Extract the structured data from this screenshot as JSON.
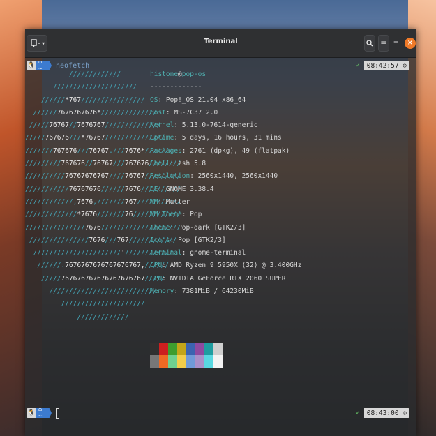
{
  "window": {
    "title": "Terminal"
  },
  "prompt1": {
    "dir_glyph": "⌂ ~",
    "command": "neofetch",
    "check": "✓",
    "time": "08:42:57"
  },
  "prompt2": {
    "dir_glyph": "⌂ ~",
    "check": "✓",
    "time": "08:43:00"
  },
  "user": {
    "name": "histone",
    "at": "@",
    "host": "pop-os",
    "separator": "-------------"
  },
  "info": [
    {
      "k": "OS",
      "v": "Pop!_OS 21.04 x86_64"
    },
    {
      "k": "Host",
      "v": "MS-7C37 2.0"
    },
    {
      "k": "Kernel",
      "v": "5.13.0-7614-generic"
    },
    {
      "k": "Uptime",
      "v": "5 days, 16 hours, 31 mins"
    },
    {
      "k": "Packages",
      "v": "2761 (dpkg), 49 (flatpak)"
    },
    {
      "k": "Shell",
      "v": "zsh 5.8"
    },
    {
      "k": "Resolution",
      "v": "2560x1440, 2560x1440"
    },
    {
      "k": "DE",
      "v": "GNOME 3.38.4"
    },
    {
      "k": "WM",
      "v": "Mutter"
    },
    {
      "k": "WM Theme",
      "v": "Pop"
    },
    {
      "k": "Theme",
      "v": "Pop-dark [GTK2/3]"
    },
    {
      "k": "Icons",
      "v": "Pop [GTK2/3]"
    },
    {
      "k": "Terminal",
      "v": "gnome-terminal"
    },
    {
      "k": "CPU",
      "v": "AMD Ryzen 9 5950X (32) @ 3.400GHz"
    },
    {
      "k": "GPU",
      "v": "NVIDIA GeForce RTX 2060 SUPER"
    },
    {
      "k": "Memory",
      "v": "7381MiB / 64230MiB"
    }
  ],
  "palette": {
    "row1": [
      "#303030",
      "#cc1f1f",
      "#3d9d2e",
      "#c3a519",
      "#3b63b0",
      "#8e4aa0",
      "#1e9da0",
      "#cfcfcf"
    ],
    "row2": [
      "#777777",
      "#ef6a24",
      "#6fd08f",
      "#f2cd4a",
      "#6f9ad8",
      "#a98fc8",
      "#58d7e0",
      "#f3f3f3"
    ]
  },
  "colors": {
    "accent": "#f07a28",
    "ascii": "#45a6b8"
  }
}
